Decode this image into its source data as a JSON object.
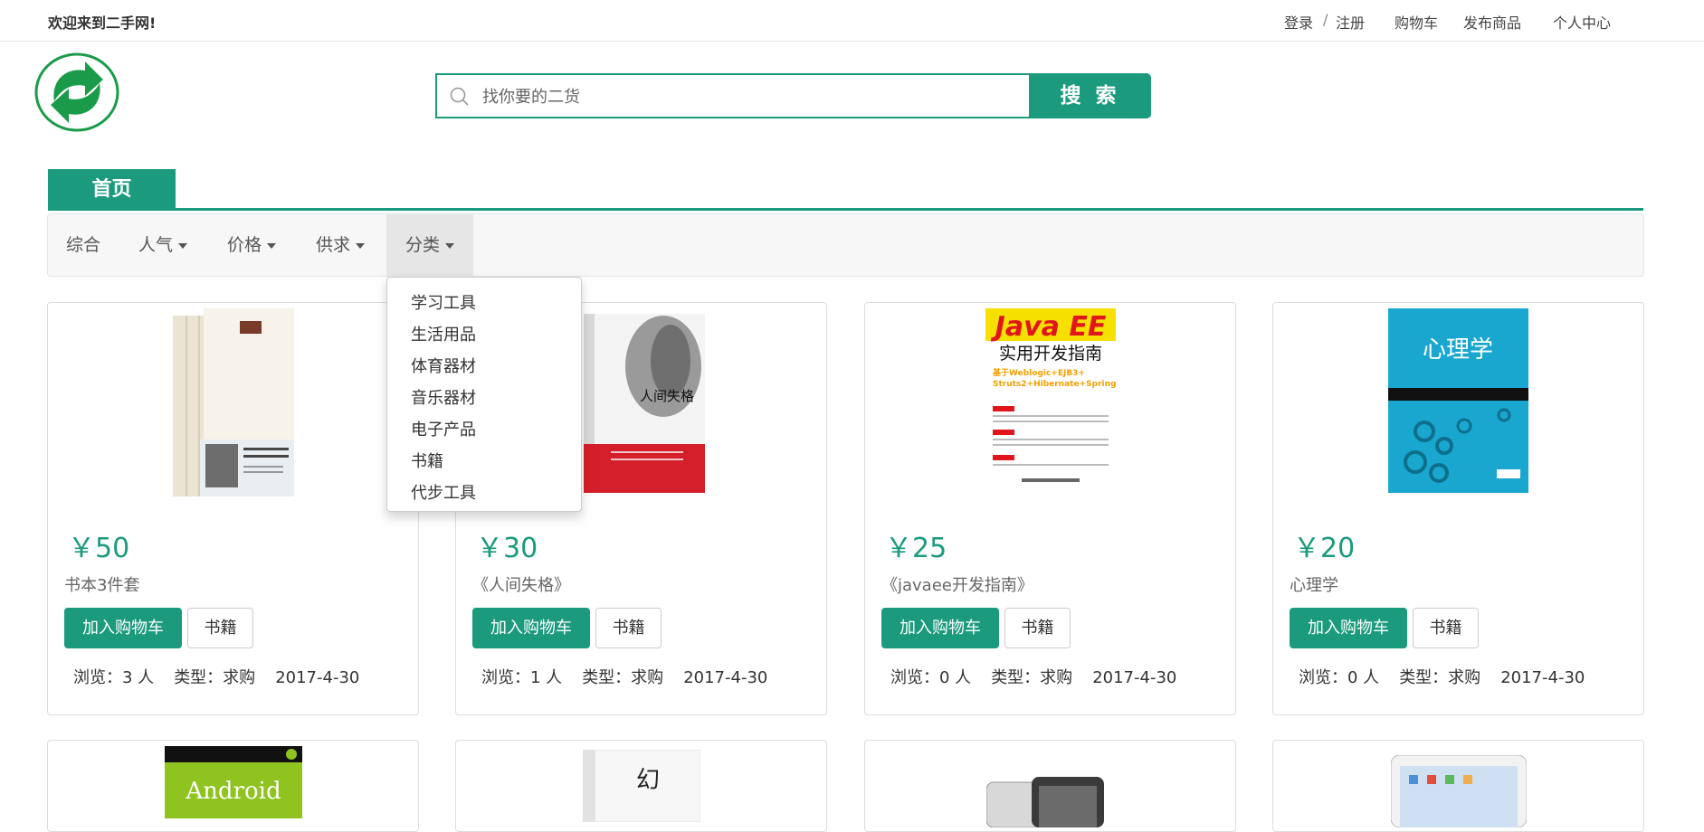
{
  "header": {
    "welcome": "欢迎来到二手网!",
    "login": "登录",
    "sep": "/",
    "register": "注册",
    "cart": "购物车",
    "publish": "发布商品",
    "profile": "个人中心"
  },
  "search": {
    "placeholder": "找你要的二货",
    "button": "搜 索"
  },
  "nav": {
    "home": "首页"
  },
  "filters": {
    "all": "综合",
    "popularity": "人气",
    "price": "价格",
    "supply": "供求",
    "category": "分类"
  },
  "category_menu": [
    "学习工具",
    "生活用品",
    "体育器材",
    "音乐器材",
    "电子产品",
    "书籍",
    "代步工具"
  ],
  "products": [
    {
      "price": "￥50",
      "title": "书本3件套",
      "category": "书籍",
      "views": "浏览：3 人",
      "type": "类型：求购",
      "date": "2017-4-30"
    },
    {
      "price": "￥30",
      "title": "《人间失格》",
      "category": "书籍",
      "views": "浏览：1 人",
      "type": "类型：求购",
      "date": "2017-4-30"
    },
    {
      "price": "￥25",
      "title": "《javaee开发指南》",
      "category": "书籍",
      "views": "浏览：0 人",
      "type": "类型：求购",
      "date": "2017-4-30"
    },
    {
      "price": "￥20",
      "title": "心理学",
      "category": "书籍",
      "views": "浏览：0 人",
      "type": "类型：求购",
      "date": "2017-4-30"
    }
  ],
  "buttons": {
    "add_cart": "加入购物车"
  },
  "covers": {
    "book2_title": "人间失格",
    "book3_line1": "Java EE",
    "book3_line2": "实用开发指南",
    "book3_line3": "基于Weblogic+EJB3+",
    "book3_line4": "Struts2+Hibernate+Spring",
    "book4_title": "心理学",
    "row2_book1": "Android",
    "row2_book2": "幻"
  },
  "colors": {
    "accent": "#1b9a7d"
  }
}
